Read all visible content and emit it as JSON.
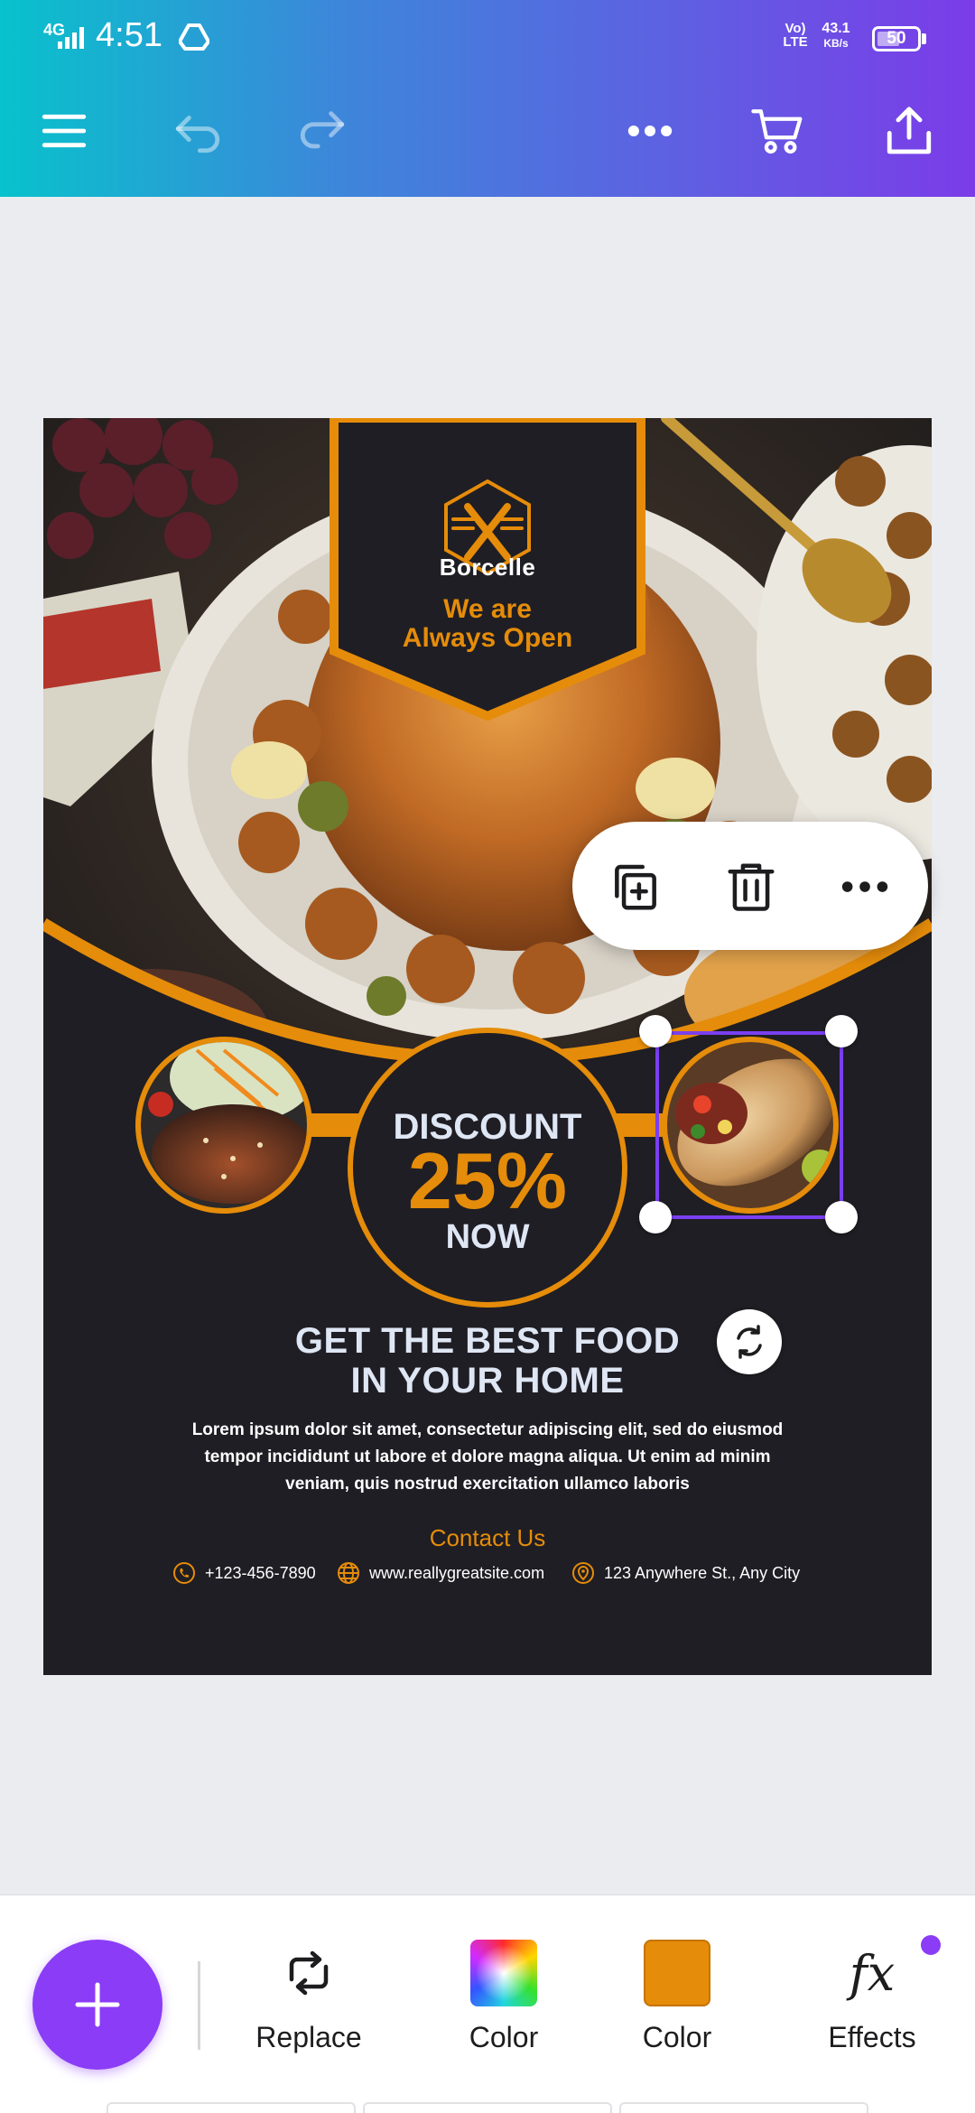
{
  "status_bar": {
    "network": "4G",
    "time": "4:51",
    "volte": "Vo) LTE",
    "speed_value": "43.1",
    "speed_unit": "KB/s",
    "battery": "50",
    "icons": [
      "signal-icon",
      "drive-icon",
      "battery-icon"
    ]
  },
  "toolbar": {
    "icons": [
      "menu-icon",
      "undo-icon",
      "redo-icon",
      "more-icon",
      "cart-icon",
      "share-icon"
    ]
  },
  "design": {
    "brand": "Borcelle",
    "tagline_line1": "We are",
    "tagline_line2": "Always Open",
    "discount_label": "DISCOUNT",
    "discount_value": "25%",
    "discount_suffix": "NOW",
    "headline_line1": "GET THE BEST FOOD",
    "headline_line2": "IN YOUR HOME",
    "body_line1": "Lorem ipsum dolor sit amet, consectetur adipiscing elit, sed do eiusmod",
    "body_line2": "tempor incididunt ut labore et dolore magna aliqua. Ut enim ad minim",
    "body_line3": "veniam, quis nostrud exercitation ullamco laboris",
    "contact_title": "Contact Us",
    "phone": "+123-456-7890",
    "website": "www.reallygreatsite.com",
    "address": "123 Anywhere St., Any City"
  },
  "context_menu": {
    "icons": [
      "duplicate-icon",
      "delete-icon",
      "more-icon"
    ]
  },
  "bottom_tools": [
    {
      "label": "Replace",
      "icon": "replace-icon"
    },
    {
      "label": "Color",
      "icon": "rainbow-color-icon"
    },
    {
      "label": "Color",
      "icon": "orange-swatch-icon"
    },
    {
      "label": "Effects",
      "icon": "fx-icon"
    }
  ],
  "colors": {
    "accent_purple": "#8b3cf6",
    "brand_orange": "#e58c0a",
    "design_bg": "#1f1e24"
  }
}
